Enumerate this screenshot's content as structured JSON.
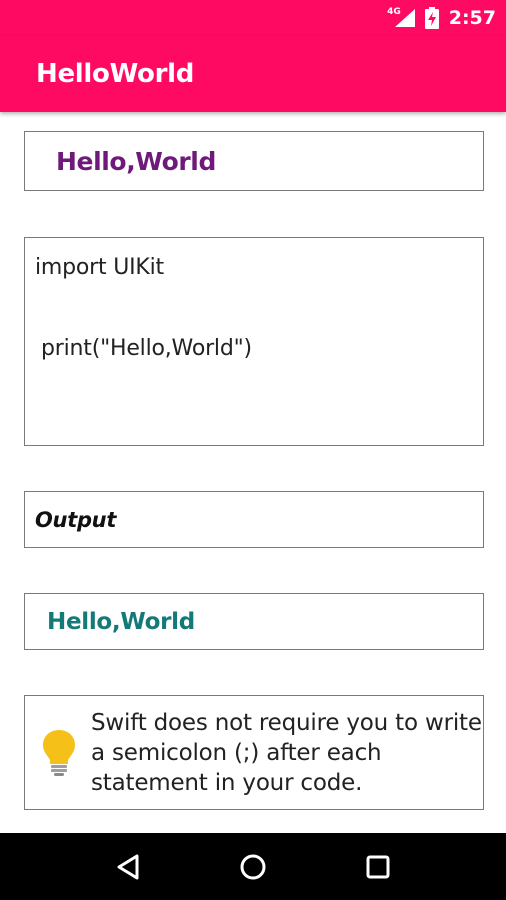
{
  "status_bar": {
    "network": "4G",
    "time": "2:57",
    "icons": [
      "signal-icon",
      "battery-charging-icon"
    ]
  },
  "app_bar": {
    "title": "HelloWorld"
  },
  "content": {
    "title": "Hello,World",
    "code": {
      "line1": "import UIKit",
      "line2": "print(\"Hello,World\")"
    },
    "output_label": "Output",
    "output_value": "Hello,World",
    "tip": {
      "icon": "lightbulb-icon",
      "text": "Swift does not require you to write a semicolon (;) after each statement in your code."
    }
  },
  "nav_bar": {
    "icons": [
      "back-icon",
      "home-icon",
      "recents-icon"
    ]
  },
  "colors": {
    "accent": "#ff0a63",
    "title_text": "#6f1a7a",
    "result_text": "#147a78",
    "lightbulb": "#f5c018"
  }
}
